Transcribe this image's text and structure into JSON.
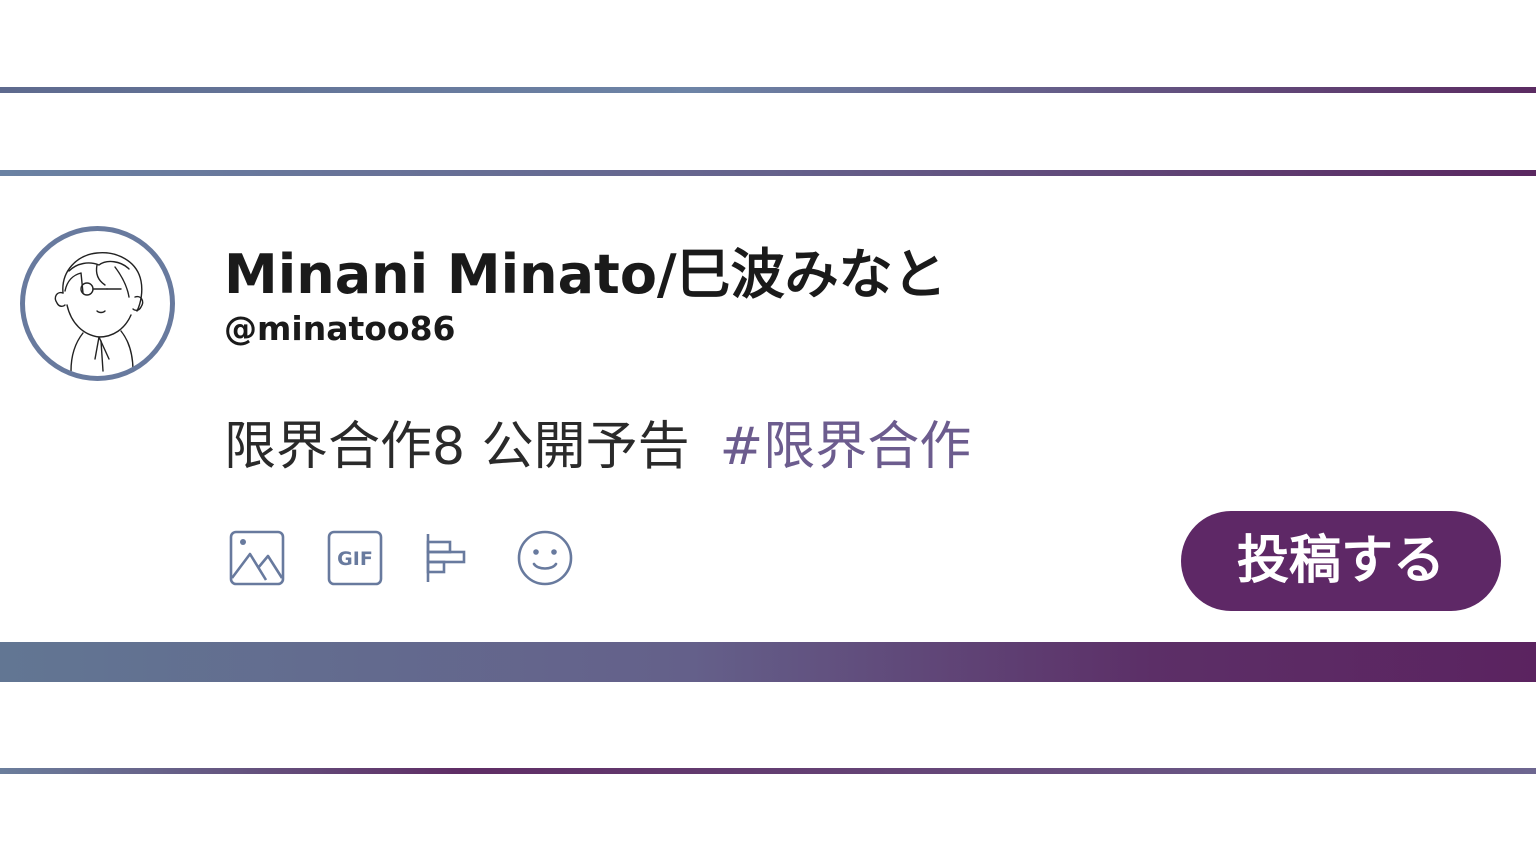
{
  "profile": {
    "display_name": "Minani Minato/巳波みなと",
    "handle": "@minatoo86"
  },
  "post": {
    "text": "限界合作8 公開予告",
    "hashtag": "#限界合作"
  },
  "toolbar": {
    "icons": [
      "image-icon",
      "gif-icon",
      "poll-icon",
      "emoji-icon"
    ],
    "gif_label": "GIF"
  },
  "post_button": {
    "label": "投稿する"
  },
  "colors": {
    "accent": "#5e2866",
    "hashtag": "#6c5c8e",
    "icon": "#687a9e",
    "avatar_ring": "#687a9e"
  }
}
